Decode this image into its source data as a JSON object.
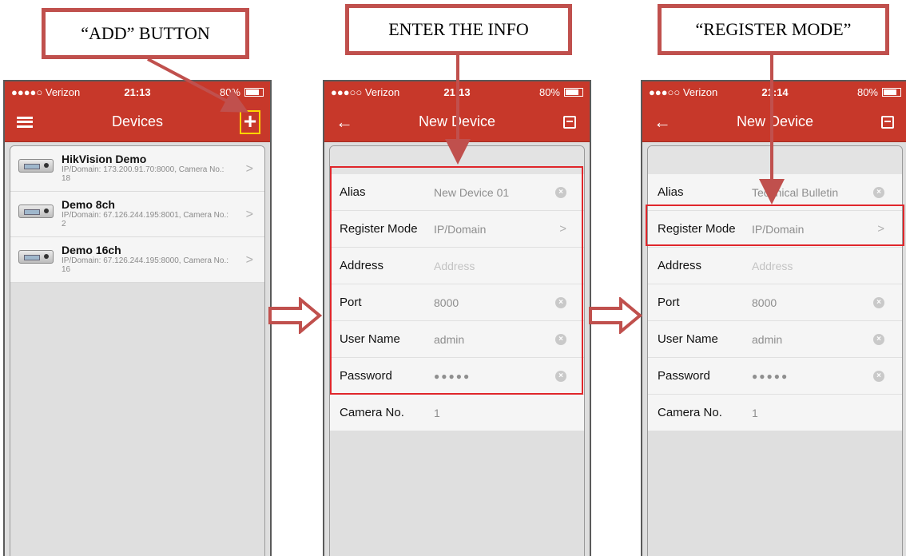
{
  "callouts": {
    "add": "“ADD” BUTTON",
    "enter": "ENTER THE INFO",
    "register": "“REGISTER MODE”"
  },
  "phone1": {
    "status": {
      "carrier": "●●●●○ Verizon",
      "time": "21:13",
      "right": "80%"
    },
    "title": "Devices",
    "devices": [
      {
        "name": "HikVision Demo",
        "sub": "IP/Domain: 173.200.91.70:8000, Camera No.: 18"
      },
      {
        "name": "Demo 8ch",
        "sub": "IP/Domain: 67.126.244.195:8001, Camera No.: 2"
      },
      {
        "name": "Demo 16ch",
        "sub": "IP/Domain: 67.126.244.195:8000, Camera No.: 16"
      }
    ]
  },
  "phone2": {
    "status": {
      "carrier": "●●●○○ Verizon",
      "time": "21:13",
      "right": "80%"
    },
    "title": "New Device",
    "fields": [
      {
        "label": "Alias",
        "value": "New Device 01"
      },
      {
        "label": "Register Mode",
        "value": "IP/Domain"
      },
      {
        "label": "Address",
        "value": "Address"
      },
      {
        "label": "Port",
        "value": "8000"
      },
      {
        "label": "User Name",
        "value": "admin"
      },
      {
        "label": "Password",
        "value": "●●●●●"
      },
      {
        "label": "Camera No.",
        "value": "1"
      }
    ]
  },
  "phone3": {
    "status": {
      "carrier": "●●●○○ Verizon",
      "time": "21:14",
      "right": "80%"
    },
    "title": "New Device",
    "fields": [
      {
        "label": "Alias",
        "value": "Technical Bulletin"
      },
      {
        "label": "Register Mode",
        "value": "IP/Domain"
      },
      {
        "label": "Address",
        "value": "Address"
      },
      {
        "label": "Port",
        "value": "8000"
      },
      {
        "label": "User Name",
        "value": "admin"
      },
      {
        "label": "Password",
        "value": "●●●●●"
      },
      {
        "label": "Camera No.",
        "value": "1"
      }
    ]
  },
  "colors": {
    "brand_red": "#c7382a",
    "annotation_red": "#c0504d",
    "highlight_yellow": "#ffd400",
    "highlight_box_red": "#e0262b"
  },
  "icons": [
    "menu-icon",
    "add-icon",
    "back-arrow-icon",
    "save-icon",
    "chevron-right-icon",
    "clear-icon",
    "dvr-device-icon"
  ]
}
